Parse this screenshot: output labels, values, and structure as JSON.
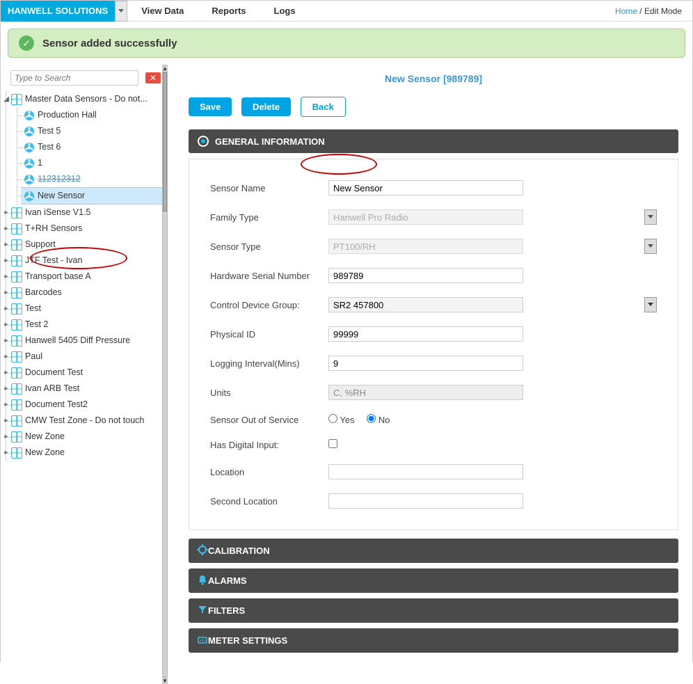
{
  "brand": "HANWELL SOLUTIONS",
  "menu": {
    "view_data": "View Data",
    "reports": "Reports",
    "logs": "Logs"
  },
  "breadcrumb": {
    "home": "Home",
    "sep": "/",
    "current": "Edit Mode"
  },
  "success_message": "Sensor added successfully",
  "search": {
    "placeholder": "Type to Search",
    "clear": "✕"
  },
  "tree": {
    "root": "Master Data Sensors - Do not...",
    "children": [
      "Production Hall",
      "Test 5",
      "Test 6",
      "1",
      "112312312",
      "New Sensor"
    ],
    "siblings": [
      "Ivan iSense V1.5",
      "T+RH Sensors",
      "Support",
      "JTF Test - Ivan",
      "Transport base A",
      "Barcodes",
      "Test",
      "Test 2",
      "Hanwell 5405 Diff Pressure",
      "Paul",
      "Document Test",
      "Ivan ARB Test",
      "Document Test2",
      "CMW Test Zone - Do not touch",
      "New Zone",
      "New Zone"
    ]
  },
  "page_title": "New Sensor [989789]",
  "buttons": {
    "save": "Save",
    "delete": "Delete",
    "back": "Back"
  },
  "sections": {
    "general": "GENERAL INFORMATION",
    "calibration": "CALIBRATION",
    "alarms": "ALARMS",
    "filters": "FILTERS",
    "meter": "METER SETTINGS"
  },
  "form": {
    "sensor_name": {
      "label": "Sensor Name",
      "value": "New Sensor"
    },
    "family_type": {
      "label": "Family Type",
      "value": "Hanwell Pro Radio"
    },
    "sensor_type": {
      "label": "Sensor Type",
      "value": "PT100/RH"
    },
    "hw_serial": {
      "label": "Hardware Serial Number",
      "value": "989789"
    },
    "cdg": {
      "label": "Control Device Group:",
      "value": "SR2 457800"
    },
    "phys_id": {
      "label": "Physical ID",
      "value": "99999"
    },
    "interval": {
      "label": "Logging Interval(Mins)",
      "value": "9"
    },
    "units": {
      "label": "Units",
      "value": "C, %RH"
    },
    "oos": {
      "label": "Sensor Out of Service",
      "yes": "Yes",
      "no": "No"
    },
    "digital": {
      "label": "Has Digital Input:"
    },
    "location": {
      "label": "Location",
      "value": ""
    },
    "location2": {
      "label": "Second Location",
      "value": ""
    }
  }
}
